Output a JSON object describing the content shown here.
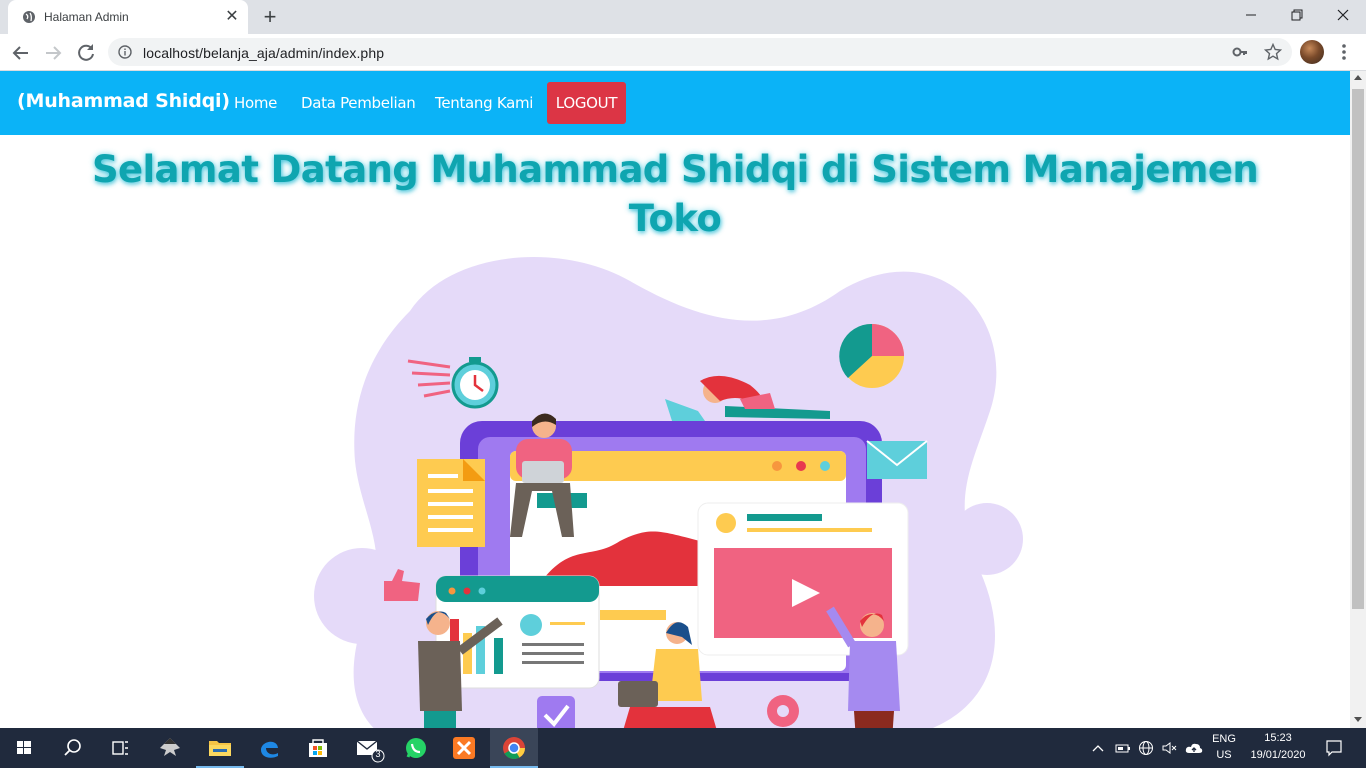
{
  "browser": {
    "tab_title": "Halaman Admin",
    "url": "localhost/belanja_aja/admin/index.php"
  },
  "site": {
    "brand": "(Muhammad Shidqi)",
    "nav": [
      {
        "label": "Home"
      },
      {
        "label": "Data Pembelian"
      },
      {
        "label": "Tentang Kami"
      }
    ],
    "logout_label": "LOGOUT",
    "welcome_line1": "Selamat Datang Muhammad Shidqi di Sistem Manajemen",
    "welcome_line2": "Toko"
  },
  "taskbar": {
    "mail_badge": "3",
    "lang_top": "ENG",
    "lang_bottom": "US",
    "time": "15:23",
    "date": "19/01/2020"
  },
  "colors": {
    "nav_bg": "#0bb3f7",
    "logout_bg": "#dc3545",
    "heading": "#0fa5b0",
    "taskbar_bg": "#202a3d"
  }
}
